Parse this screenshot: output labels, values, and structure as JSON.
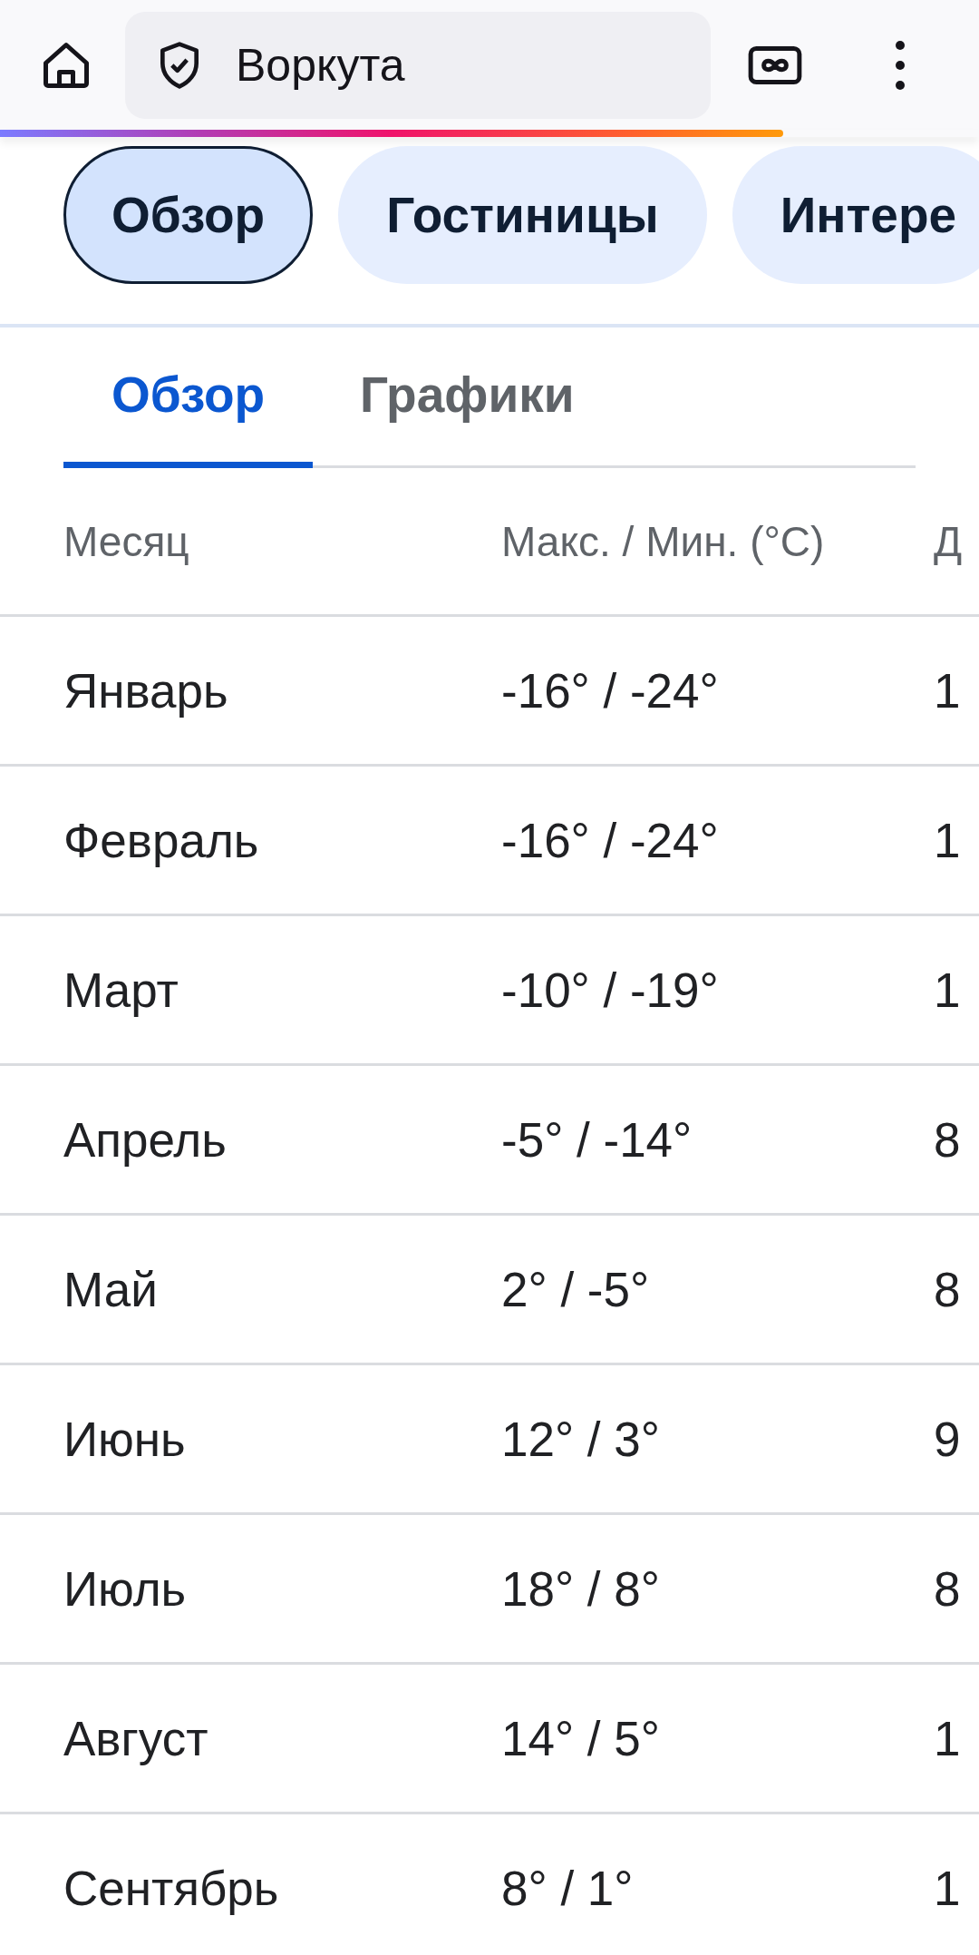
{
  "address_bar": {
    "text": "Воркута",
    "level": 0.8
  },
  "chips": [
    {
      "label": "Обзор",
      "selected": true
    },
    {
      "label": "Гостиницы",
      "selected": false
    },
    {
      "label": "Интере",
      "selected": false
    }
  ],
  "tabs": [
    {
      "label": "Обзор",
      "selected": true
    },
    {
      "label": "Графики",
      "selected": false
    }
  ],
  "table": {
    "columns": [
      "Месяц",
      "Макс. / Мин.  (°C)",
      "Д"
    ],
    "rows": [
      [
        "Январь",
        "-16° / -24°",
        "1"
      ],
      [
        "Февраль",
        "-16° / -24°",
        "1"
      ],
      [
        "Март",
        "-10° / -19°",
        "1"
      ],
      [
        "Апрель",
        "-5° / -14°",
        "8"
      ],
      [
        "Май",
        "2° / -5°",
        "8"
      ],
      [
        "Июнь",
        "12° / 3°",
        "9"
      ],
      [
        "Июль",
        "18° / 8°",
        "8"
      ],
      [
        "Август",
        "14° / 5°",
        "1"
      ],
      [
        "Сентябрь",
        "8° / 1°",
        "1"
      ]
    ]
  }
}
